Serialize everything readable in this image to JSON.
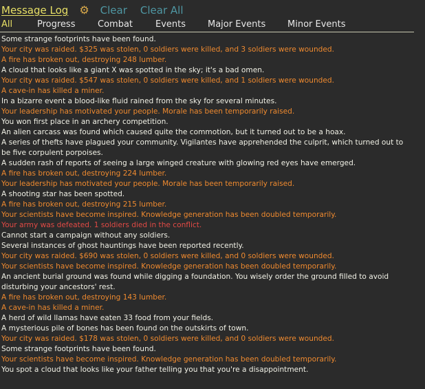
{
  "header": {
    "title": "Message Log",
    "settings_icon": "gear-icon",
    "clear_label": "Clear",
    "clear_all_label": "Clear All"
  },
  "tabs": [
    {
      "label": "All",
      "active": true
    },
    {
      "label": "Progress",
      "active": false
    },
    {
      "label": "Combat",
      "active": false
    },
    {
      "label": "Events",
      "active": false
    },
    {
      "label": "Major Events",
      "active": false
    },
    {
      "label": "Minor Events",
      "active": false
    }
  ],
  "colors": {
    "background": "#2b2b2b",
    "title": "#e8e066",
    "button": "#4f97a3",
    "gear": "#d9a94a",
    "message_normal": "#f1f1e6",
    "message_warning": "#ef8a2f",
    "message_danger": "#e24a45"
  },
  "messages": [
    {
      "text": "Some strange footprints have been found.",
      "tone": "w"
    },
    {
      "text": "Your city was raided. $325 was stolen, 0 soldiers were killed, and 3 soldiers were wounded.",
      "tone": "o"
    },
    {
      "text": "A fire has broken out, destroying 248 lumber.",
      "tone": "o"
    },
    {
      "text": "A cloud that looks like a giant X was spotted in the sky; it's a bad omen.",
      "tone": "w"
    },
    {
      "text": "Your city was raided. $547 was stolen, 0 soldiers were killed, and 1 soldiers were wounded.",
      "tone": "o"
    },
    {
      "text": "A cave-in has killed a miner.",
      "tone": "o"
    },
    {
      "text": "In a bizarre event a blood-like fluid rained from the sky for several minutes.",
      "tone": "w"
    },
    {
      "text": "Your leadership has motivated your people. Morale has been temporarily raised.",
      "tone": "o"
    },
    {
      "text": "You won first place in an archery competition.",
      "tone": "w"
    },
    {
      "text": "An alien carcass was found which caused quite the commotion, but it turned out to be a hoax.",
      "tone": "w"
    },
    {
      "text": "A series of thefts have plagued your community. Vigilantes have apprehended the culprit, which turned out to be five corpulent porpoises.",
      "tone": "w"
    },
    {
      "text": "A sudden rash of reports of seeing a large winged creature with glowing red eyes have emerged.",
      "tone": "w"
    },
    {
      "text": "A fire has broken out, destroying 224 lumber.",
      "tone": "o"
    },
    {
      "text": "Your leadership has motivated your people. Morale has been temporarily raised.",
      "tone": "o"
    },
    {
      "text": "A shooting star has been spotted.",
      "tone": "w"
    },
    {
      "text": "A fire has broken out, destroying 215 lumber.",
      "tone": "o"
    },
    {
      "text": "Your scientists have become inspired. Knowledge generation has been doubled temporarily.",
      "tone": "o"
    },
    {
      "text": "Your army was defeated. 1 soldiers died in the conflict.",
      "tone": "r"
    },
    {
      "text": "Cannot start a campaign without any soldiers.",
      "tone": "w"
    },
    {
      "text": "Several instances of ghost hauntings have been reported recently.",
      "tone": "w"
    },
    {
      "text": "Your city was raided. $690 was stolen, 0 soldiers were killed, and 0 soldiers were wounded.",
      "tone": "o"
    },
    {
      "text": "Your scientists have become inspired. Knowledge generation has been doubled temporarily.",
      "tone": "o"
    },
    {
      "text": "An ancient burial ground was found while digging a foundation. You wisely order the ground filled to avoid disturbing your ancestors' rest.",
      "tone": "w"
    },
    {
      "text": "A fire has broken out, destroying 143 lumber.",
      "tone": "o"
    },
    {
      "text": "A cave-in has killed a miner.",
      "tone": "o"
    },
    {
      "text": "A herd of wild llamas have eaten 33 food from your fields.",
      "tone": "w"
    },
    {
      "text": "A mysterious pile of bones has been found on the outskirts of town.",
      "tone": "w"
    },
    {
      "text": "Your city was raided. $178 was stolen, 0 soldiers were killed, and 0 soldiers were wounded.",
      "tone": "o"
    },
    {
      "text": "Some strange footprints have been found.",
      "tone": "w"
    },
    {
      "text": "Your scientists have become inspired. Knowledge generation has been doubled temporarily.",
      "tone": "o"
    },
    {
      "text": "You spot a cloud that looks like your father telling you that you're a disappointment.",
      "tone": "w"
    }
  ]
}
